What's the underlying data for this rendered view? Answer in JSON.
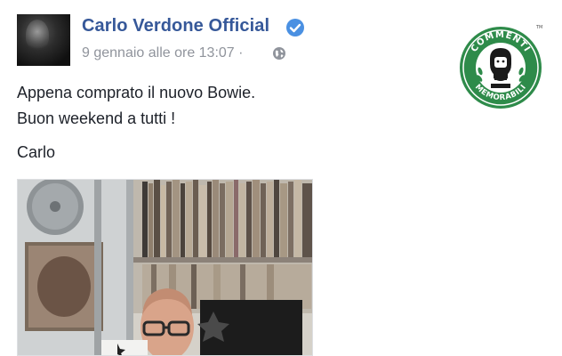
{
  "post": {
    "author": "Carlo Verdone Official",
    "timestamp": "9 gennaio alle ore 13:07",
    "separator": "·",
    "text_line1": "Appena comprato il nuovo Bowie.",
    "text_line2": "Buon weekend a tutti !",
    "signature": "Carlo"
  },
  "icons": {
    "verified": "verified-badge-icon",
    "audience": "globe-icon"
  },
  "logo": {
    "top_text": "COMMENTI",
    "bottom_text": "MEMORABILI",
    "tm": "TM"
  },
  "colors": {
    "author_link": "#365899",
    "meta_gray": "#90949c",
    "verified_blue": "#4a90e2",
    "logo_green": "#2e8b4a"
  }
}
